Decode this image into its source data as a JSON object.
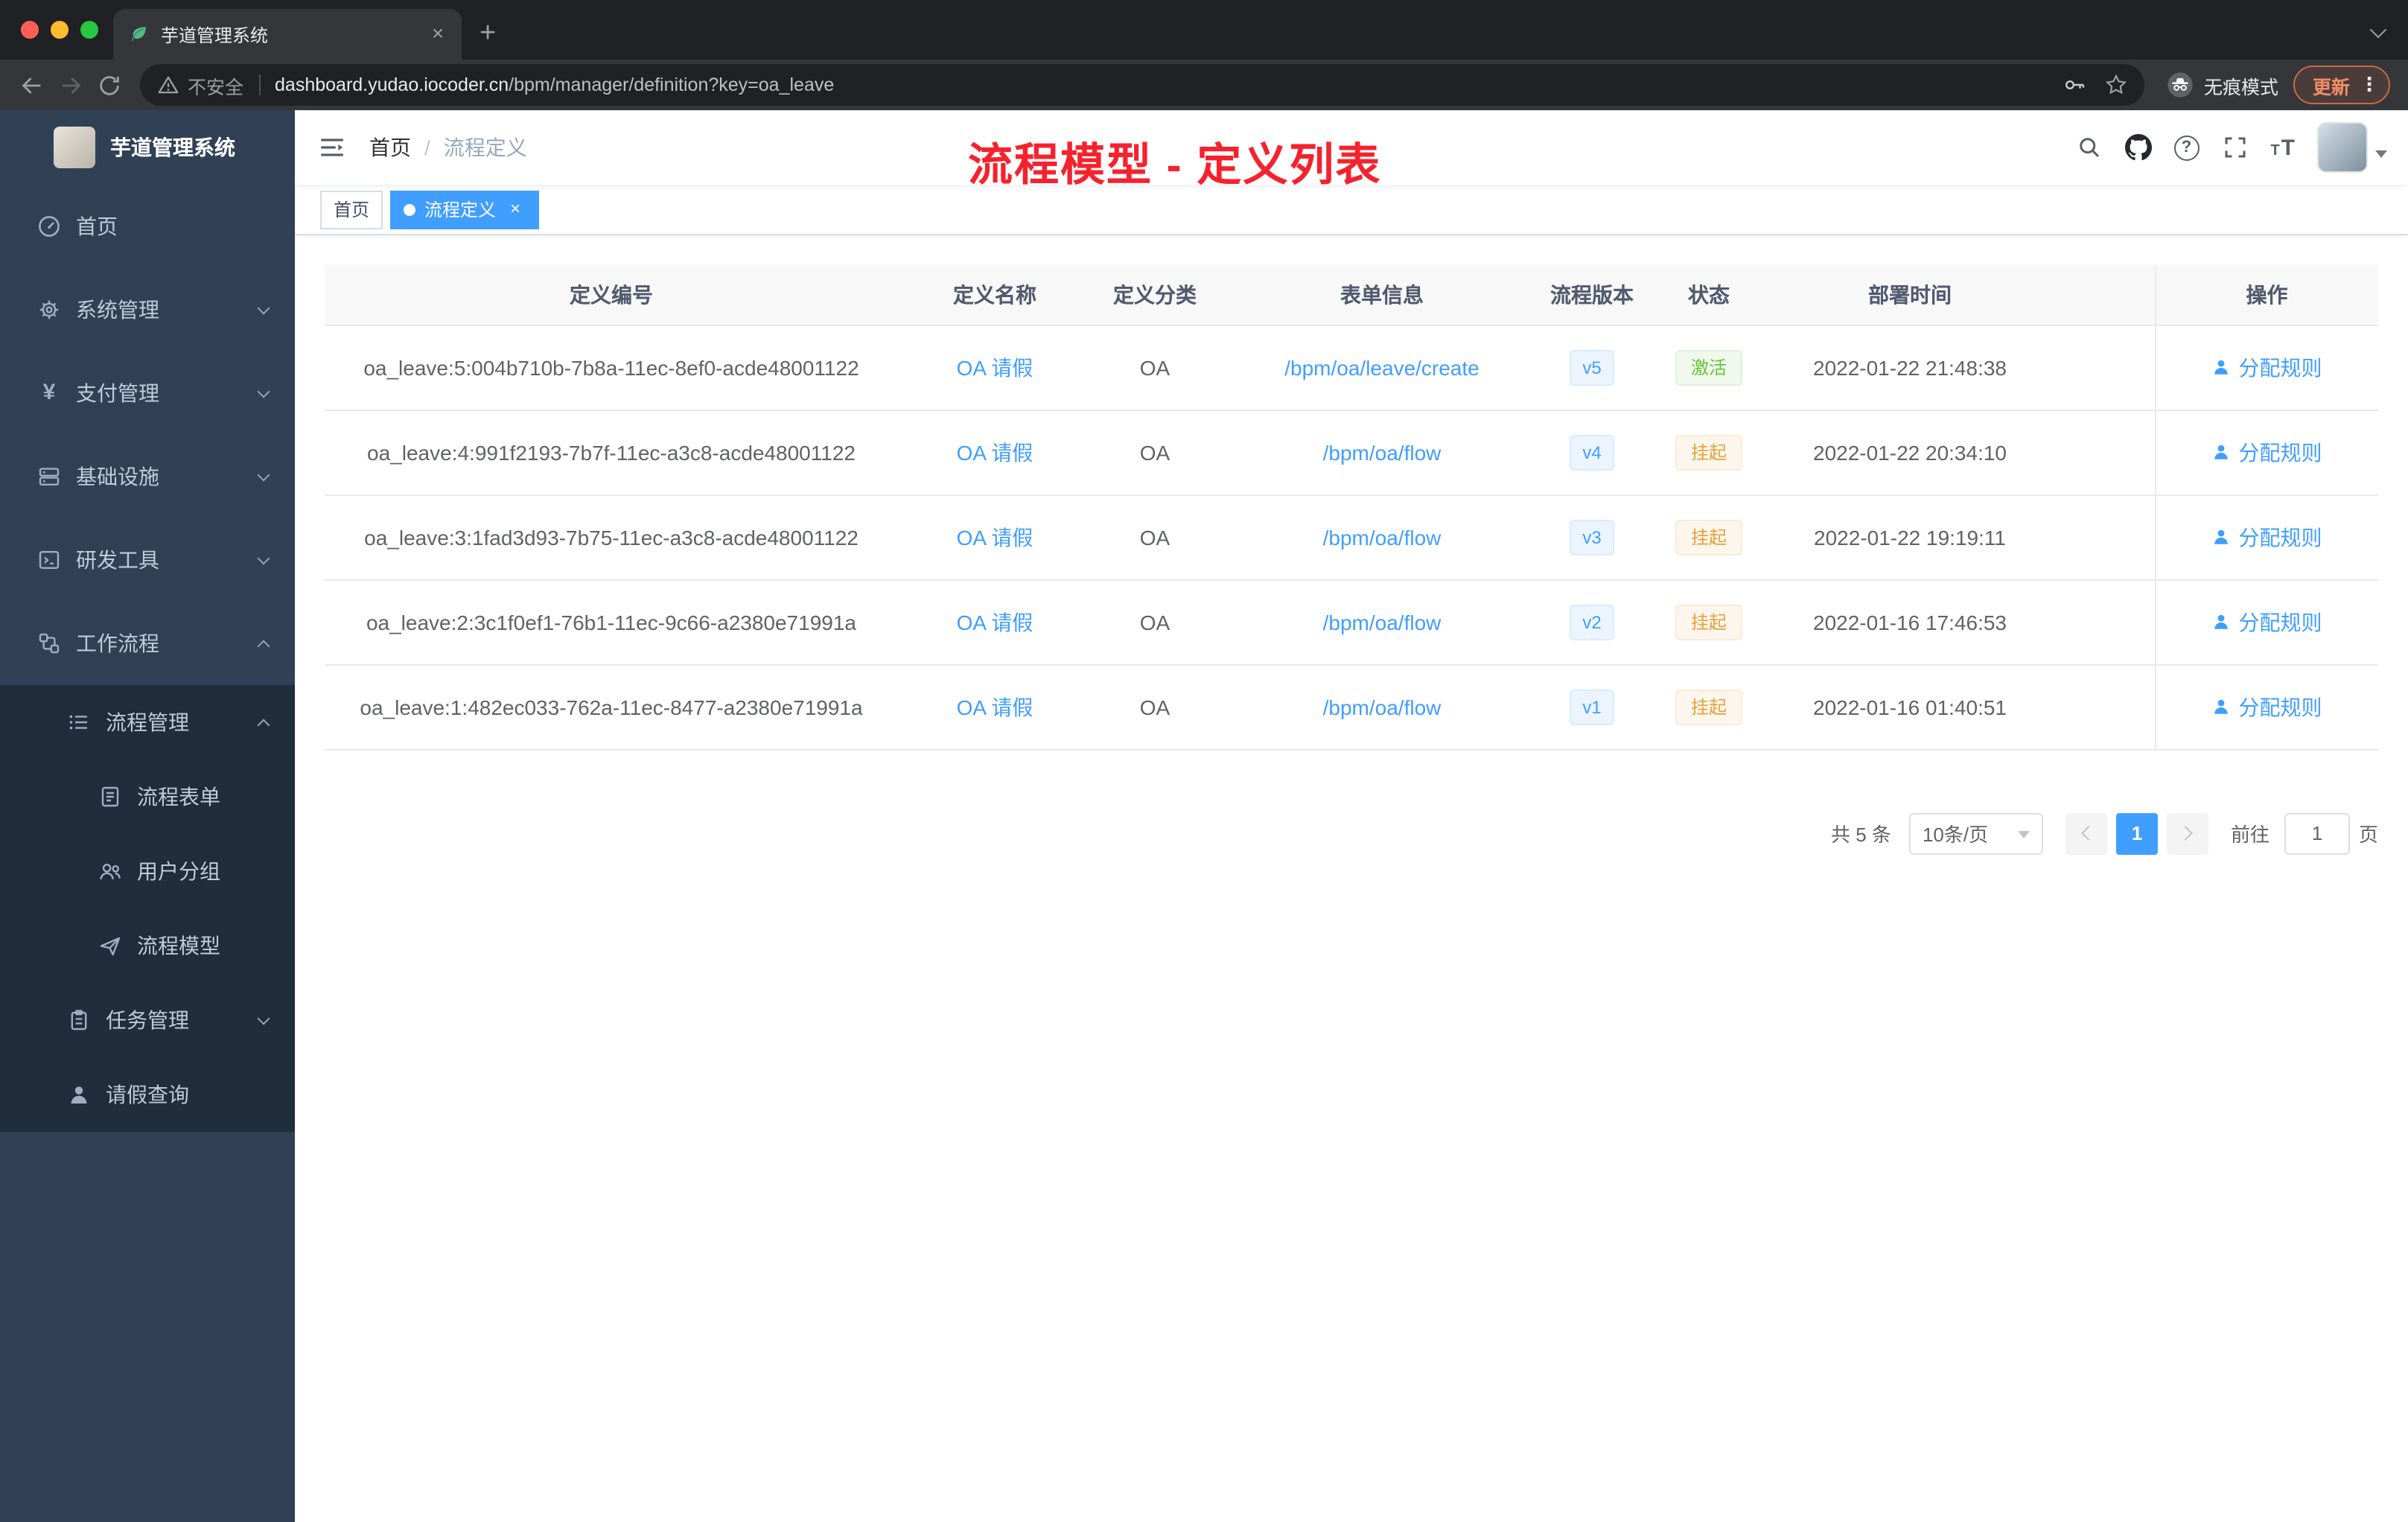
{
  "browser": {
    "tab": {
      "title": "芋道管理系统"
    },
    "glyphs": {
      "close": "×",
      "plus": "+",
      "kebab": "⋮"
    },
    "address": {
      "security_label": "不安全",
      "domain": "dashboard.yudao.iocoder.cn",
      "path": "/bpm/manager/definition?key=oa_leave"
    },
    "incognito_label": "无痕模式",
    "update_label": "更新"
  },
  "sidebar": {
    "logo_title": "芋道管理系统",
    "menu": [
      {
        "label": "首页"
      },
      {
        "label": "系统管理"
      },
      {
        "label": "支付管理"
      },
      {
        "label": "基础设施"
      },
      {
        "label": "研发工具"
      },
      {
        "label": "工作流程"
      },
      {
        "label": "流程管理"
      },
      {
        "label": "流程表单"
      },
      {
        "label": "用户分组"
      },
      {
        "label": "流程模型"
      },
      {
        "label": "任务管理"
      },
      {
        "label": "请假查询"
      }
    ],
    "yen_glyph": "¥"
  },
  "header": {
    "breadcrumb": {
      "home": "首页",
      "separator": "/",
      "current": "流程定义"
    },
    "annotation": "流程模型 - 定义列表",
    "help_glyph": "?",
    "font_glyph_small": "T",
    "font_glyph_large": "T"
  },
  "tags": {
    "items": [
      {
        "label": "首页",
        "active": false
      },
      {
        "label": "流程定义",
        "active": true
      }
    ],
    "close_glyph": "×"
  },
  "table": {
    "columns": [
      "定义编号",
      "定义名称",
      "定义分类",
      "表单信息",
      "流程版本",
      "状态",
      "部署时间",
      "操作"
    ],
    "action_label": "分配规则",
    "rows": [
      {
        "id": "oa_leave:5:004b710b-7b8a-11ec-8ef0-acde48001122",
        "name": "OA 请假",
        "category": "OA",
        "form": "/bpm/oa/leave/create",
        "version": "v5",
        "status": "激活",
        "time": "2022-01-22 21:48:38"
      },
      {
        "id": "oa_leave:4:991f2193-7b7f-11ec-a3c8-acde48001122",
        "name": "OA 请假",
        "category": "OA",
        "form": "/bpm/oa/flow",
        "version": "v4",
        "status": "挂起",
        "time": "2022-01-22 20:34:10"
      },
      {
        "id": "oa_leave:3:1fad3d93-7b75-11ec-a3c8-acde48001122",
        "name": "OA 请假",
        "category": "OA",
        "form": "/bpm/oa/flow",
        "version": "v3",
        "status": "挂起",
        "time": "2022-01-22 19:19:11"
      },
      {
        "id": "oa_leave:2:3c1f0ef1-76b1-11ec-9c66-a2380e71991a",
        "name": "OA 请假",
        "category": "OA",
        "form": "/bpm/oa/flow",
        "version": "v2",
        "status": "挂起",
        "time": "2022-01-16 17:46:53"
      },
      {
        "id": "oa_leave:1:482ec033-762a-11ec-8477-a2380e71991a",
        "name": "OA 请假",
        "category": "OA",
        "form": "/bpm/oa/flow",
        "version": "v1",
        "status": "挂起",
        "time": "2022-01-16 01:40:51"
      }
    ]
  },
  "pagination": {
    "total": "共 5 条",
    "page_size": "10条/页",
    "current_page": "1",
    "goto_label": "前往",
    "goto_value": "1",
    "page_unit": "页"
  },
  "colors": {
    "accent_blue": "#409eff",
    "status_active_green": "#67c23a",
    "status_suspended_orange": "#e6a23c",
    "annotation_red": "#f5222d",
    "sidebar_bg": "#304156",
    "submenu_bg": "#1f2d3d"
  }
}
